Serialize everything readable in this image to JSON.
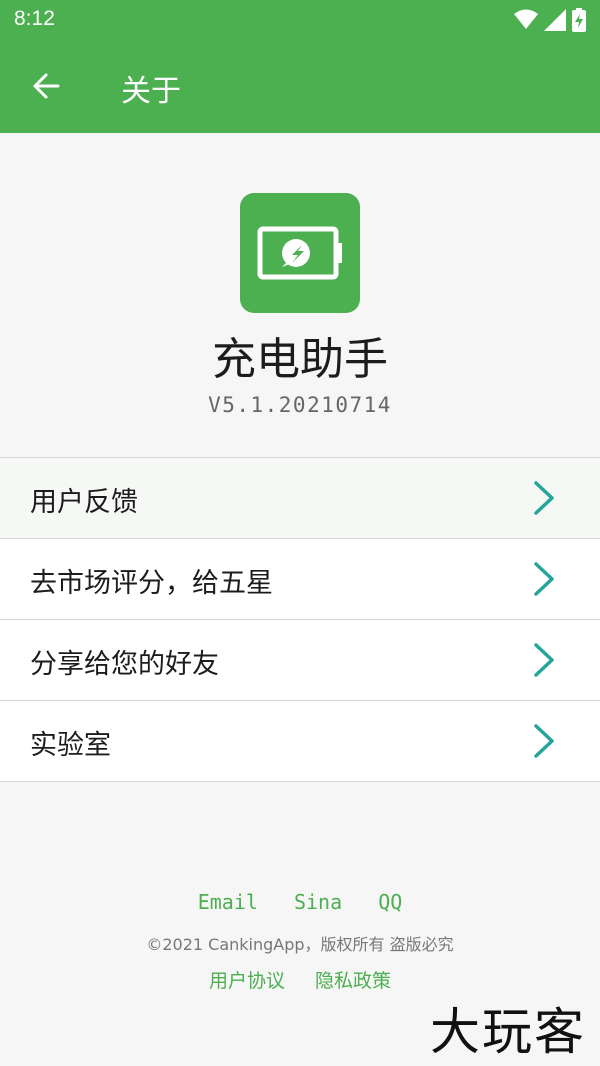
{
  "status_bar": {
    "time": "8:12"
  },
  "app_bar": {
    "title": "关于"
  },
  "app": {
    "name": "充电助手",
    "version": "V5.1.20210714"
  },
  "menu": [
    {
      "label": "用户反馈"
    },
    {
      "label": "去市场评分，给五星"
    },
    {
      "label": "分享给您的好友"
    },
    {
      "label": "实验室"
    }
  ],
  "footer": {
    "links": [
      "Email",
      "Sina",
      "QQ"
    ],
    "copyright": "©2021 CankingApp，版权所有 盗版必究",
    "policies": [
      "用户协议",
      "隐私政策"
    ]
  },
  "watermark": "大玩客",
  "colors": {
    "primary": "#4caf50",
    "chevron": "#26a69a"
  }
}
